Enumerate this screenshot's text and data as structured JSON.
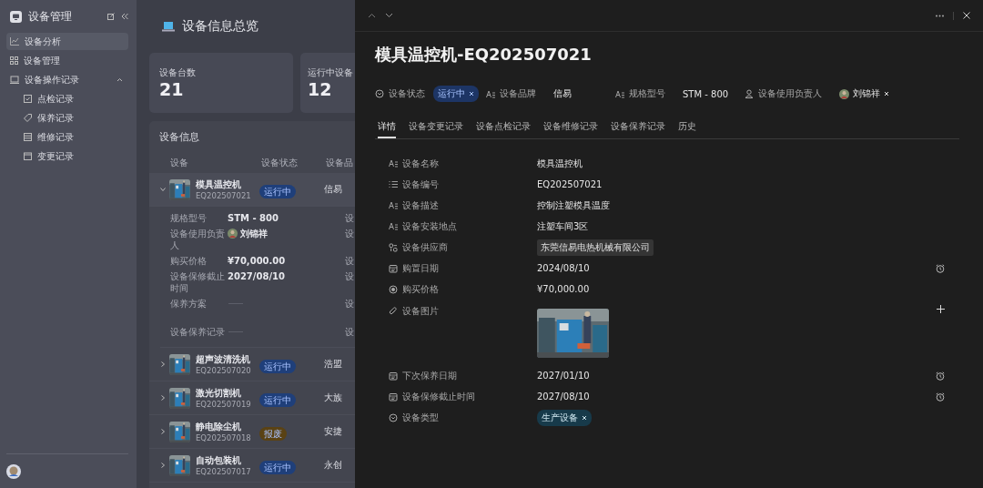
{
  "sidebar": {
    "title": "设备管理",
    "items": [
      {
        "label": "设备分析",
        "selected": true
      },
      {
        "label": "设备管理",
        "selected": false
      },
      {
        "label": "设备操作记录",
        "selected": false,
        "expanded": true,
        "children": [
          {
            "label": "点检记录",
            "selected": false
          },
          {
            "label": "保养记录",
            "selected": false
          },
          {
            "label": "维修记录",
            "selected": false
          },
          {
            "label": "变更记录",
            "selected": false
          }
        ]
      }
    ]
  },
  "main": {
    "title": "设备信息总览",
    "stats": [
      {
        "label": "设备台数",
        "value": "21"
      },
      {
        "label": "运行中设备",
        "value": "12"
      }
    ],
    "table": {
      "title": "设备信息",
      "columns": [
        "设备",
        "设备状态",
        "设备品"
      ],
      "rows": [
        {
          "name": "模具温控机",
          "code": "EQ202507021",
          "status": "运行中",
          "color": "#1f3f7a",
          "brand": "信易",
          "expanded": true,
          "details": [
            {
              "label": "规格型号",
              "kind": "text",
              "value": "STM - 800"
            },
            {
              "label": "设备使用负责人",
              "kind": "person",
              "value": "刘锦祥"
            },
            {
              "label": "购买价格",
              "kind": "text",
              "value": "¥70,000.00"
            },
            {
              "label": "设备保修截止时间",
              "kind": "text",
              "value": "2027/08/10"
            },
            {
              "label": "保养方案",
              "kind": "empty"
            },
            {
              "label": "设备保养记录",
              "kind": "empty"
            }
          ],
          "column_3": [
            "设",
            "设",
            "设",
            "设",
            "设",
            "设"
          ]
        },
        {
          "name": "超声波清洗机",
          "code": "EQ202507020",
          "status": "运行中",
          "color": "#1f3f7a",
          "brand": "浩盟",
          "expanded": false
        },
        {
          "name": "激光切割机",
          "code": "EQ202507019",
          "status": "运行中",
          "color": "#1f3f7a",
          "brand": "大族",
          "expanded": false
        },
        {
          "name": "静电除尘机",
          "code": "EQ202507018",
          "status": "报废",
          "color": "#5a4214",
          "brand": "安捷",
          "expanded": false
        },
        {
          "name": "自动包装机",
          "code": "EQ202507017",
          "status": "运行中",
          "color": "#1f3f7a",
          "brand": "永创",
          "expanded": false
        }
      ]
    }
  },
  "drawer": {
    "title": "模具温控机-EQ202507021",
    "properties": [
      {
        "label": "设备状态",
        "kind": "select",
        "value": "运行中"
      },
      {
        "label": "设备品牌",
        "kind": "text",
        "value": "信易"
      },
      {
        "label": "规格型号",
        "kind": "text",
        "value": "STM - 800"
      },
      {
        "label": "设备使用负责人",
        "kind": "person",
        "value": "刘锦祥"
      }
    ],
    "tabs": [
      {
        "label": "详情",
        "selected": true
      },
      {
        "label": "设备变更记录",
        "selected": false
      },
      {
        "label": "设备点检记录",
        "selected": false
      },
      {
        "label": "设备维修记录",
        "selected": false
      },
      {
        "label": "设备保养记录",
        "selected": false
      },
      {
        "label": "历史",
        "selected": false
      }
    ],
    "fields": [
      {
        "label": "设备名称",
        "kind": "text",
        "value": "模具温控机"
      },
      {
        "label": "设备编号",
        "kind": "serial",
        "value": "EQ202507021"
      },
      {
        "label": "设备描述",
        "kind": "text",
        "value": "控制注塑模具温度"
      },
      {
        "label": "设备安装地点",
        "kind": "text",
        "value": "注塑车间3区"
      },
      {
        "label": "设备供应商",
        "kind": "tag",
        "value": "东莞信易电热机械有限公司"
      },
      {
        "label": "购置日期",
        "kind": "date",
        "value": "2024/08/10"
      },
      {
        "label": "购买价格",
        "kind": "money",
        "value": "¥70,000.00"
      },
      {
        "label": "设备图片"
      },
      {
        "label": "下次保养日期",
        "kind": "date",
        "value": "2027/01/10"
      },
      {
        "label": "设备保修截止时间",
        "kind": "date",
        "value": "2027/08/10"
      },
      {
        "label": "设备类型",
        "kind": "select",
        "value": "生产设备"
      }
    ]
  }
}
